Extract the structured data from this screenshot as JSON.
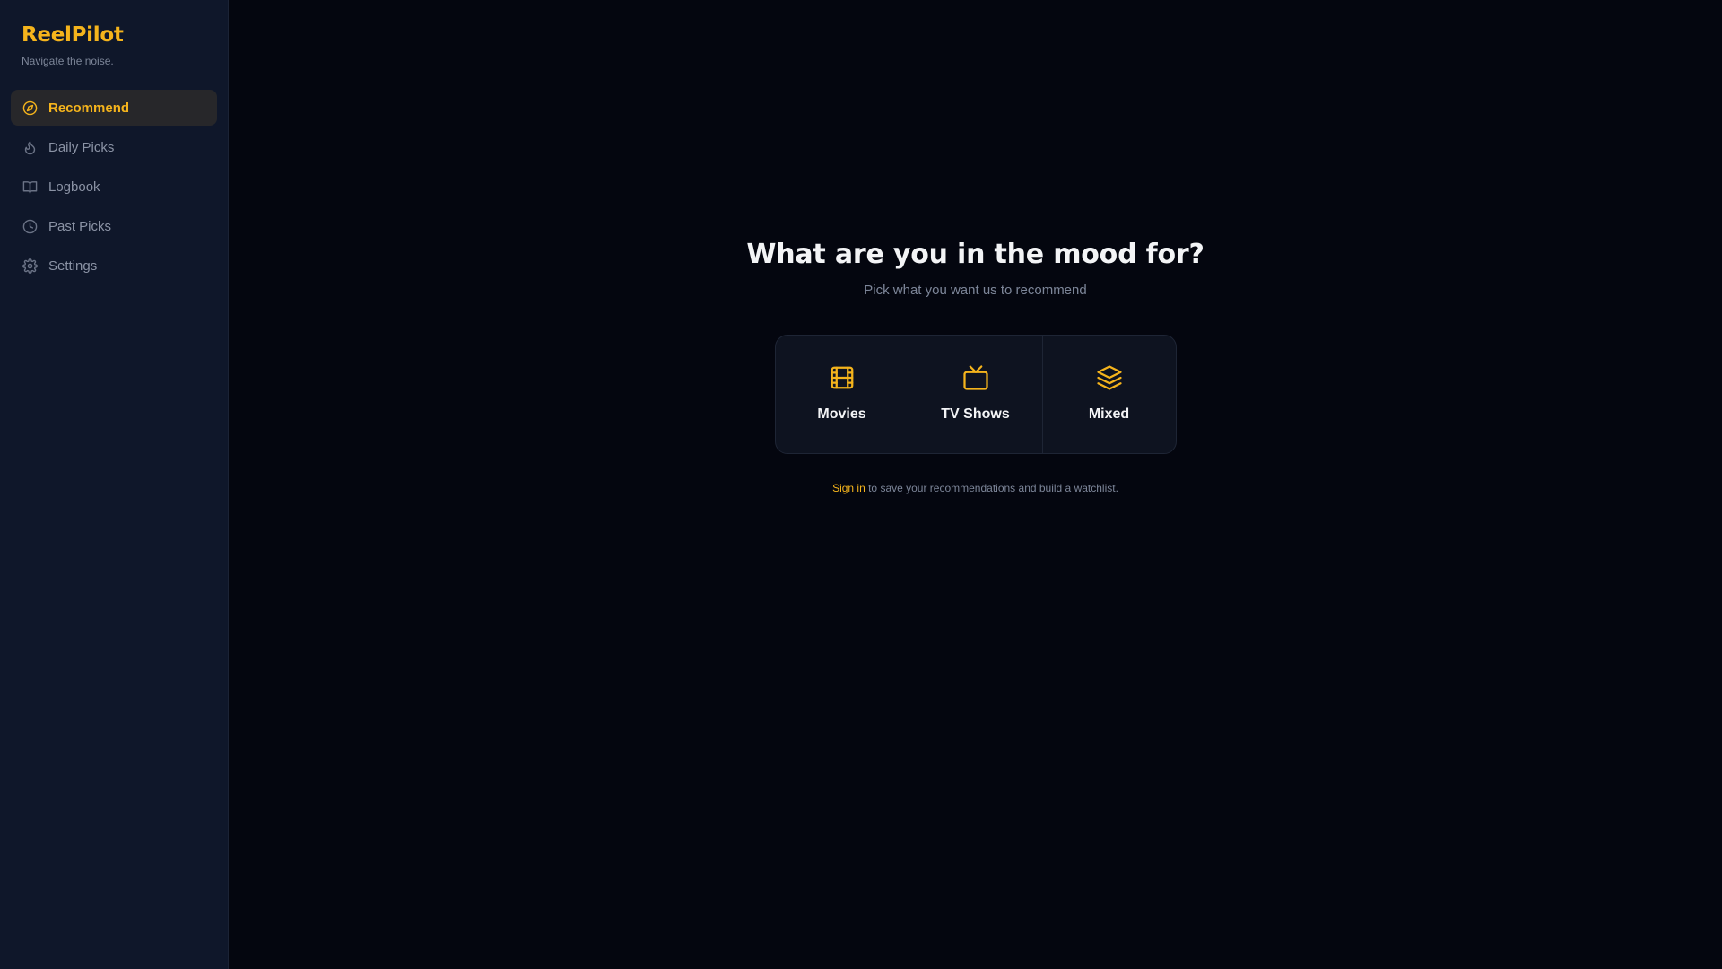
{
  "app": {
    "title": "ReelPilot",
    "tagline": "Navigate the noise.",
    "accent_color": "#f5b41c"
  },
  "sidebar": {
    "items": [
      {
        "label": "Recommend",
        "icon": "compass-icon",
        "active": true
      },
      {
        "label": "Daily Picks",
        "icon": "flame-icon",
        "active": false
      },
      {
        "label": "Logbook",
        "icon": "book-icon",
        "active": false
      },
      {
        "label": "Past Picks",
        "icon": "clock-icon",
        "active": false
      },
      {
        "label": "Settings",
        "icon": "gear-icon",
        "active": false
      }
    ]
  },
  "main": {
    "headline": "What are you in the mood for?",
    "subheadline": "Pick what you want us to recommend",
    "choices": [
      {
        "label": "Movies",
        "icon": "film-icon"
      },
      {
        "label": "TV Shows",
        "icon": "tv-icon"
      },
      {
        "label": "Mixed",
        "icon": "layers-icon"
      }
    ],
    "signin": {
      "link_label": "Sign in",
      "text": " to save your recommendations and build a watchlist."
    }
  }
}
